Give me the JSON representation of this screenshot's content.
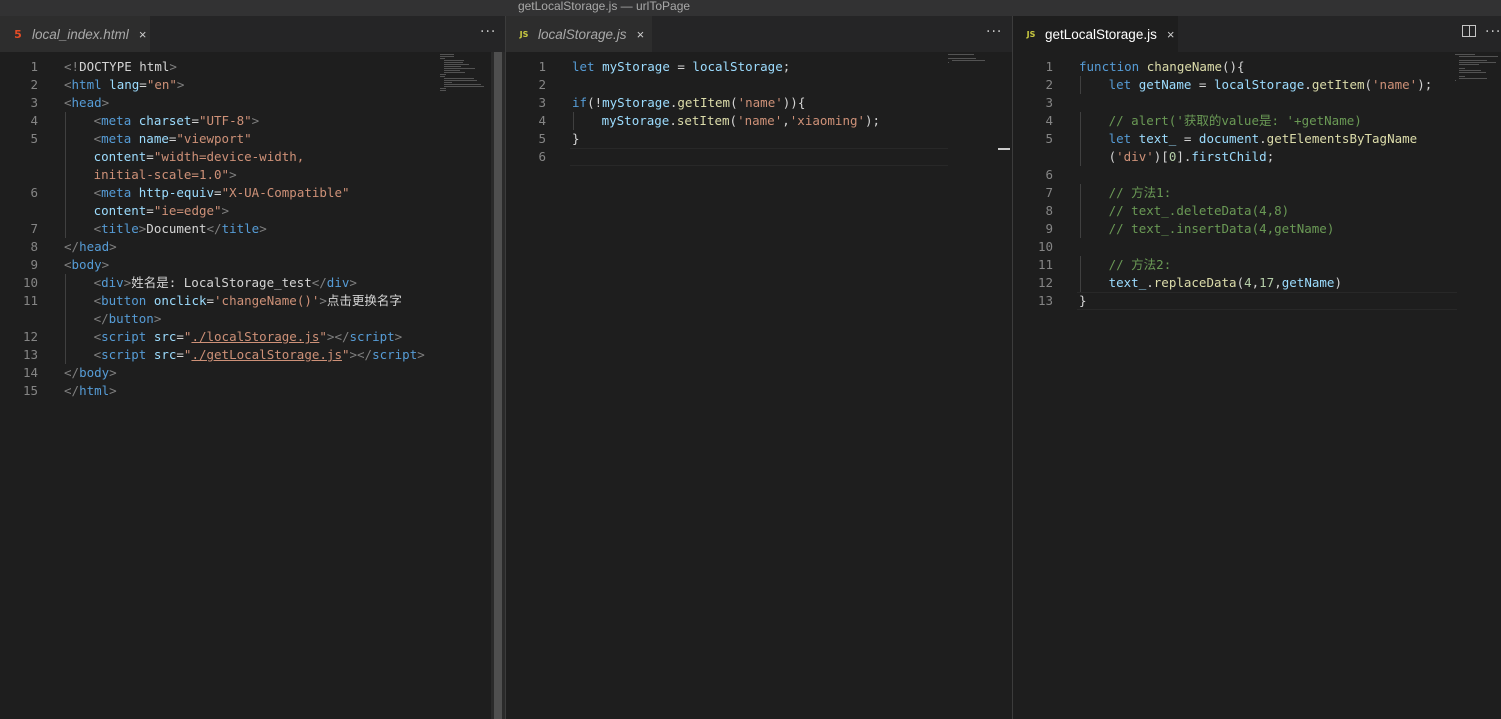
{
  "window": {
    "title": "getLocalStorage.js — urlToPage"
  },
  "groups": [
    {
      "tab": {
        "label": "local_index.html",
        "close": "×",
        "icon": "html5-icon",
        "active": false
      },
      "more": "···",
      "lines": [
        {
          "n": "1",
          "indent": 0,
          "tokens": [
            [
              "t-br",
              "<!"
            ],
            [
              "t-def",
              "DOCTYPE html"
            ],
            [
              "t-br",
              ">"
            ]
          ]
        },
        {
          "n": "2",
          "indent": 0,
          "tokens": [
            [
              "t-br",
              "<"
            ],
            [
              "t-tag",
              "html "
            ],
            [
              "t-attr",
              "lang"
            ],
            [
              "t-def",
              "="
            ],
            [
              "t-str",
              "\"en\""
            ],
            [
              "t-br",
              ">"
            ]
          ]
        },
        {
          "n": "3",
          "indent": 0,
          "tokens": [
            [
              "t-br",
              "<"
            ],
            [
              "t-tag",
              "head"
            ],
            [
              "t-br",
              ">"
            ]
          ]
        },
        {
          "n": "4",
          "indent": 1,
          "tokens": [
            [
              "t-br",
              "<"
            ],
            [
              "t-tag",
              "meta "
            ],
            [
              "t-attr",
              "charset"
            ],
            [
              "t-def",
              "="
            ],
            [
              "t-str",
              "\"UTF-8\""
            ],
            [
              "t-br",
              ">"
            ]
          ]
        },
        {
          "n": "5",
          "indent": 1,
          "tokens": [
            [
              "t-br",
              "<"
            ],
            [
              "t-tag",
              "meta "
            ],
            [
              "t-attr",
              "name"
            ],
            [
              "t-def",
              "="
            ],
            [
              "t-str",
              "\"viewport\""
            ]
          ]
        },
        {
          "n": "",
          "indent": 1,
          "tokens": [
            [
              "t-attr",
              "content"
            ],
            [
              "t-def",
              "="
            ],
            [
              "t-str",
              "\"width=device-width,"
            ]
          ]
        },
        {
          "n": "",
          "indent": 1,
          "tokens": [
            [
              "t-str",
              "initial-scale=1.0\""
            ],
            [
              "t-br",
              ">"
            ]
          ]
        },
        {
          "n": "6",
          "indent": 1,
          "tokens": [
            [
              "t-br",
              "<"
            ],
            [
              "t-tag",
              "meta "
            ],
            [
              "t-attr",
              "http-equiv"
            ],
            [
              "t-def",
              "="
            ],
            [
              "t-str",
              "\"X-UA-Compatible\""
            ]
          ]
        },
        {
          "n": "",
          "indent": 1,
          "tokens": [
            [
              "t-attr",
              "content"
            ],
            [
              "t-def",
              "="
            ],
            [
              "t-str",
              "\"ie=edge\""
            ],
            [
              "t-br",
              ">"
            ]
          ]
        },
        {
          "n": "7",
          "indent": 1,
          "tokens": [
            [
              "t-br",
              "<"
            ],
            [
              "t-tag",
              "title"
            ],
            [
              "t-br",
              ">"
            ],
            [
              "t-def",
              "Document"
            ],
            [
              "t-br",
              "</"
            ],
            [
              "t-tag",
              "title"
            ],
            [
              "t-br",
              ">"
            ]
          ]
        },
        {
          "n": "8",
          "indent": 0,
          "tokens": [
            [
              "t-br",
              "</"
            ],
            [
              "t-tag",
              "head"
            ],
            [
              "t-br",
              ">"
            ]
          ]
        },
        {
          "n": "9",
          "indent": 0,
          "tokens": [
            [
              "t-br",
              "<"
            ],
            [
              "t-tag",
              "body"
            ],
            [
              "t-br",
              ">"
            ]
          ]
        },
        {
          "n": "10",
          "indent": 1,
          "tokens": [
            [
              "t-br",
              "<"
            ],
            [
              "t-tag",
              "div"
            ],
            [
              "t-br",
              ">"
            ],
            [
              "t-def",
              "姓名是: LocalStorage_test"
            ],
            [
              "t-br",
              "</"
            ],
            [
              "t-tag",
              "div"
            ],
            [
              "t-br",
              ">"
            ]
          ]
        },
        {
          "n": "11",
          "indent": 1,
          "tokens": [
            [
              "t-br",
              "<"
            ],
            [
              "t-tag",
              "button "
            ],
            [
              "t-attr",
              "onclick"
            ],
            [
              "t-def",
              "="
            ],
            [
              "t-str",
              "'changeName()'"
            ],
            [
              "t-br",
              ">"
            ],
            [
              "t-def",
              "点击更换名字"
            ]
          ]
        },
        {
          "n": "",
          "indent": 1,
          "tokens": [
            [
              "t-br",
              "</"
            ],
            [
              "t-tag",
              "button"
            ],
            [
              "t-br",
              ">"
            ]
          ]
        },
        {
          "n": "12",
          "indent": 1,
          "tokens": [
            [
              "t-br",
              "<"
            ],
            [
              "t-tag",
              "script "
            ],
            [
              "t-attr",
              "src"
            ],
            [
              "t-def",
              "="
            ],
            [
              "t-str",
              "\""
            ],
            [
              "t-str t-und",
              "./localStorage.js"
            ],
            [
              "t-str",
              "\""
            ],
            [
              "t-br",
              "></"
            ],
            [
              "t-tag",
              "script"
            ],
            [
              "t-br",
              ">"
            ]
          ]
        },
        {
          "n": "13",
          "indent": 1,
          "tokens": [
            [
              "t-br",
              "<"
            ],
            [
              "t-tag",
              "script "
            ],
            [
              "t-attr",
              "src"
            ],
            [
              "t-def",
              "="
            ],
            [
              "t-str",
              "\""
            ],
            [
              "t-str t-und",
              "./getLocalStorage.js"
            ],
            [
              "t-str",
              "\""
            ],
            [
              "t-br",
              "></"
            ],
            [
              "t-tag",
              "script"
            ],
            [
              "t-br",
              ">"
            ]
          ]
        },
        {
          "n": "14",
          "indent": 0,
          "tokens": [
            [
              "t-br",
              "</"
            ],
            [
              "t-tag",
              "body"
            ],
            [
              "t-br",
              ">"
            ]
          ]
        },
        {
          "n": "15",
          "indent": 0,
          "tokens": [
            [
              "t-br",
              "</"
            ],
            [
              "t-tag",
              "html"
            ],
            [
              "t-br",
              ">"
            ]
          ]
        }
      ]
    },
    {
      "tab": {
        "label": "localStorage.js",
        "close": "×",
        "icon": "js-icon",
        "active": false
      },
      "more": "···",
      "lines": [
        {
          "n": "1",
          "indent": 0,
          "tokens": [
            [
              "t-kw",
              "let "
            ],
            [
              "t-var",
              "myStorage"
            ],
            [
              "t-def",
              " = "
            ],
            [
              "t-var",
              "localStorage"
            ],
            [
              "t-def",
              ";"
            ]
          ]
        },
        {
          "n": "2",
          "indent": 0,
          "tokens": []
        },
        {
          "n": "3",
          "indent": 0,
          "tokens": [
            [
              "t-kw",
              "if"
            ],
            [
              "t-def",
              "(!"
            ],
            [
              "t-var",
              "myStorage"
            ],
            [
              "t-def",
              "."
            ],
            [
              "t-fn",
              "getItem"
            ],
            [
              "t-def",
              "("
            ],
            [
              "t-str",
              "'name'"
            ],
            [
              "t-def",
              ")){"
            ]
          ]
        },
        {
          "n": "4",
          "indent": 1,
          "tokens": [
            [
              "t-var",
              "myStorage"
            ],
            [
              "t-def",
              "."
            ],
            [
              "t-fn",
              "setItem"
            ],
            [
              "t-def",
              "("
            ],
            [
              "t-str",
              "'name'"
            ],
            [
              "t-def",
              ","
            ],
            [
              "t-str",
              "'xiaoming'"
            ],
            [
              "t-def",
              ");"
            ]
          ]
        },
        {
          "n": "5",
          "indent": 0,
          "tokens": [
            [
              "t-def",
              "}"
            ]
          ]
        },
        {
          "n": "6",
          "indent": 0,
          "tokens": []
        }
      ]
    },
    {
      "tab": {
        "label": "getLocalStorage.js",
        "close": "×",
        "icon": "js-icon",
        "active": true
      },
      "more": "···",
      "lines": [
        {
          "n": "1",
          "indent": 0,
          "tokens": [
            [
              "t-kw",
              "function "
            ],
            [
              "t-fn",
              "changeName"
            ],
            [
              "t-def",
              "(){"
            ]
          ]
        },
        {
          "n": "2",
          "indent": 1,
          "tokens": [
            [
              "t-kw",
              "let "
            ],
            [
              "t-var",
              "getName"
            ],
            [
              "t-def",
              " = "
            ],
            [
              "t-var",
              "localStorage"
            ],
            [
              "t-def",
              "."
            ],
            [
              "t-fn",
              "getItem"
            ],
            [
              "t-def",
              "("
            ],
            [
              "t-str",
              "'name'"
            ],
            [
              "t-def",
              ");"
            ]
          ]
        },
        {
          "n": "3",
          "indent": 0,
          "tokens": []
        },
        {
          "n": "4",
          "indent": 1,
          "tokens": [
            [
              "t-com",
              "// alert('获取的value是: '+getName)"
            ]
          ]
        },
        {
          "n": "5",
          "indent": 1,
          "tokens": [
            [
              "t-kw",
              "let "
            ],
            [
              "t-var",
              "text_"
            ],
            [
              "t-def",
              " = "
            ],
            [
              "t-var",
              "document"
            ],
            [
              "t-def",
              "."
            ],
            [
              "t-fn",
              "getElementsByTagName"
            ]
          ]
        },
        {
          "n": "",
          "indent": 1,
          "tokens": [
            [
              "t-def",
              "("
            ],
            [
              "t-str",
              "'div'"
            ],
            [
              "t-def",
              ")["
            ],
            [
              "t-num",
              "0"
            ],
            [
              "t-def",
              "]."
            ],
            [
              "t-var",
              "firstChild"
            ],
            [
              "t-def",
              ";"
            ]
          ]
        },
        {
          "n": "6",
          "indent": 0,
          "tokens": []
        },
        {
          "n": "7",
          "indent": 1,
          "tokens": [
            [
              "t-com",
              "// 方法1:"
            ]
          ]
        },
        {
          "n": "8",
          "indent": 1,
          "tokens": [
            [
              "t-com",
              "// text_.deleteData(4,8)"
            ]
          ]
        },
        {
          "n": "9",
          "indent": 1,
          "tokens": [
            [
              "t-com",
              "// text_.insertData(4,getName)"
            ]
          ]
        },
        {
          "n": "10",
          "indent": 0,
          "tokens": []
        },
        {
          "n": "11",
          "indent": 1,
          "tokens": [
            [
              "t-com",
              "// 方法2:"
            ]
          ]
        },
        {
          "n": "12",
          "indent": 1,
          "tokens": [
            [
              "t-var",
              "text_"
            ],
            [
              "t-def",
              "."
            ],
            [
              "t-fn",
              "replaceData"
            ],
            [
              "t-def",
              "("
            ],
            [
              "t-num",
              "4"
            ],
            [
              "t-def",
              ","
            ],
            [
              "t-num",
              "17"
            ],
            [
              "t-def",
              ","
            ],
            [
              "t-var",
              "getName"
            ],
            [
              "t-def",
              ")"
            ]
          ]
        },
        {
          "n": "13",
          "indent": 0,
          "tokens": [
            [
              "t-def",
              "}"
            ]
          ]
        }
      ]
    }
  ]
}
